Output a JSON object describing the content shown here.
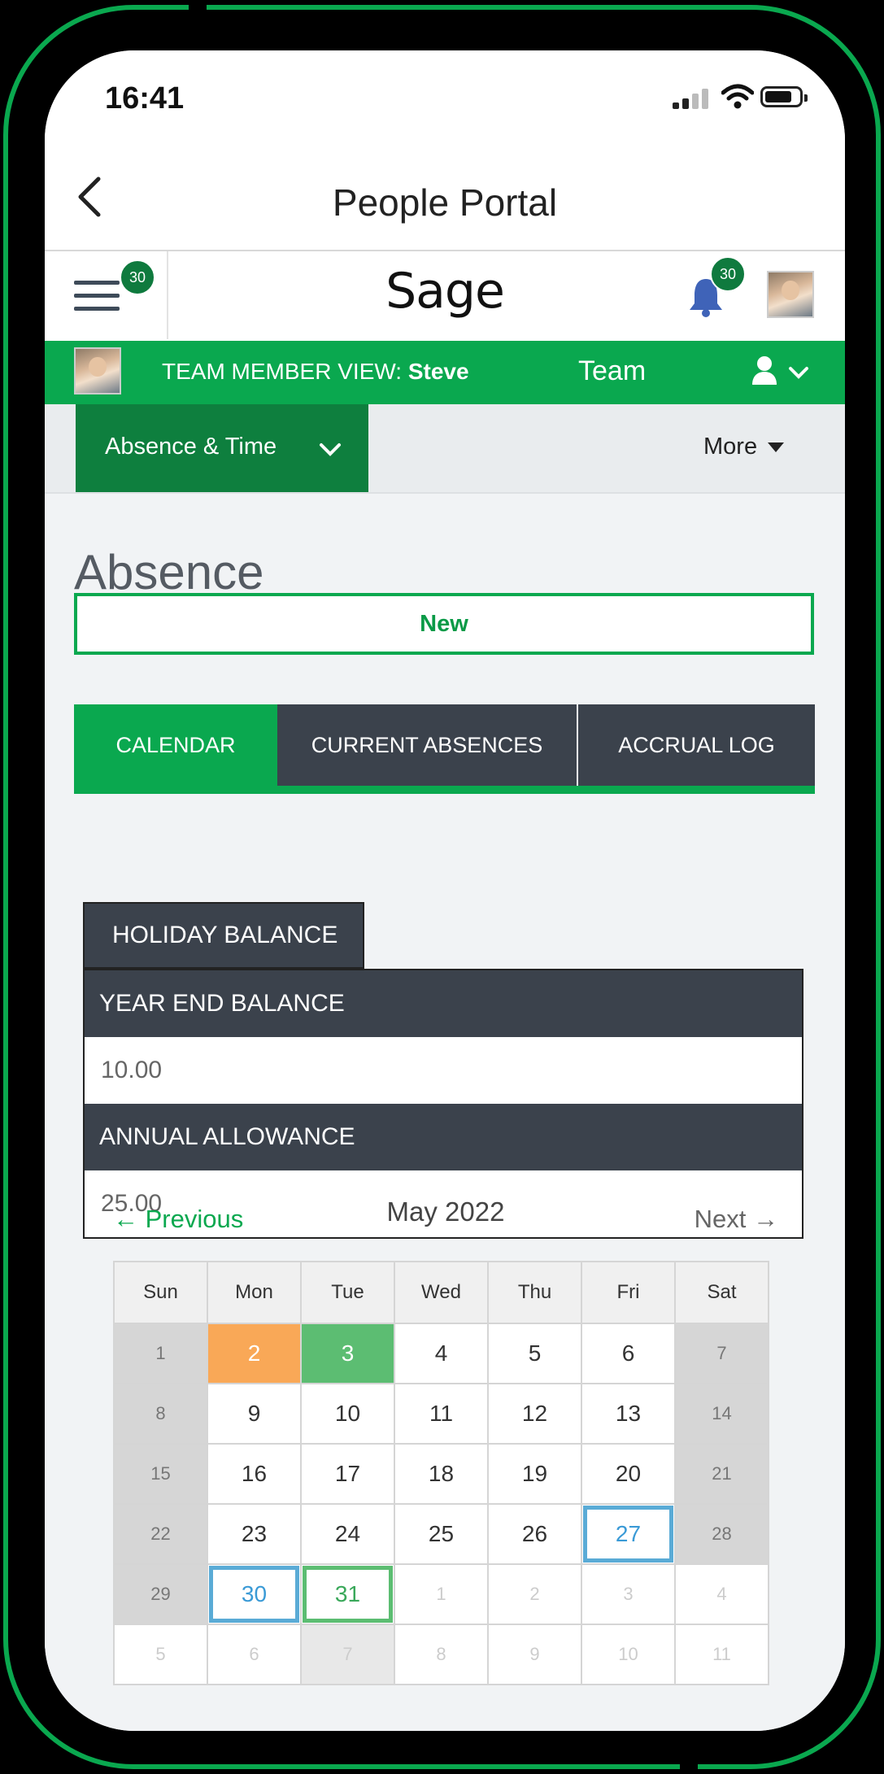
{
  "status_bar": {
    "time": "16:41"
  },
  "nav": {
    "title": "People Portal"
  },
  "sage_bar": {
    "logo": "Sage",
    "menu_badge": "30",
    "notification_badge": "30"
  },
  "team_bar": {
    "view_label": "TEAM MEMBER VIEW:",
    "user_name": "Steve",
    "team_label": "Team"
  },
  "subnav": {
    "section": "Absence & Time",
    "more": "More"
  },
  "page": {
    "heading": "Absence",
    "new_button": "New"
  },
  "tabs": [
    {
      "label": "CALENDAR",
      "active": true
    },
    {
      "label": "CURRENT ABSENCES",
      "active": false
    },
    {
      "label": "ACCRUAL LOG",
      "active": false
    }
  ],
  "balance": {
    "header": "HOLIDAY BALANCE",
    "rows": [
      {
        "label": "YEAR END BALANCE",
        "value": "10.00"
      },
      {
        "label": "ANNUAL ALLOWANCE",
        "value": "25.00"
      }
    ]
  },
  "calendar": {
    "prev": "← Previous",
    "month": "May 2022",
    "next": "Next →",
    "weekdays": [
      "Sun",
      "Mon",
      "Tue",
      "Wed",
      "Thu",
      "Fri",
      "Sat"
    ],
    "weeks": [
      [
        {
          "d": "1",
          "t": "weekend"
        },
        {
          "d": "2",
          "t": "orange"
        },
        {
          "d": "3",
          "t": "green"
        },
        {
          "d": "4"
        },
        {
          "d": "5"
        },
        {
          "d": "6"
        },
        {
          "d": "7",
          "t": "weekend"
        }
      ],
      [
        {
          "d": "8",
          "t": "weekend"
        },
        {
          "d": "9"
        },
        {
          "d": "10"
        },
        {
          "d": "11"
        },
        {
          "d": "12"
        },
        {
          "d": "13"
        },
        {
          "d": "14",
          "t": "weekend"
        }
      ],
      [
        {
          "d": "15",
          "t": "weekend"
        },
        {
          "d": "16"
        },
        {
          "d": "17"
        },
        {
          "d": "18"
        },
        {
          "d": "19"
        },
        {
          "d": "20"
        },
        {
          "d": "21",
          "t": "weekend"
        }
      ],
      [
        {
          "d": "22",
          "t": "weekend"
        },
        {
          "d": "23"
        },
        {
          "d": "24"
        },
        {
          "d": "25"
        },
        {
          "d": "26"
        },
        {
          "d": "27",
          "t": "blue-out"
        },
        {
          "d": "28",
          "t": "weekend"
        }
      ],
      [
        {
          "d": "29",
          "t": "weekend"
        },
        {
          "d": "30",
          "t": "blue-out"
        },
        {
          "d": "31",
          "t": "green-out"
        },
        {
          "d": "1",
          "t": "other"
        },
        {
          "d": "2",
          "t": "other"
        },
        {
          "d": "3",
          "t": "other"
        },
        {
          "d": "4",
          "t": "other"
        }
      ],
      [
        {
          "d": "5",
          "t": "other"
        },
        {
          "d": "6",
          "t": "other"
        },
        {
          "d": "7",
          "t": "other grey"
        },
        {
          "d": "8",
          "t": "other"
        },
        {
          "d": "9",
          "t": "other"
        },
        {
          "d": "10",
          "t": "other"
        },
        {
          "d": "11",
          "t": "other"
        }
      ]
    ]
  },
  "colors": {
    "brand_green": "#0aa84f",
    "dark_green": "#0e7f3e",
    "dark_slate": "#3b424c",
    "absence_orange": "#f9a857",
    "absence_green": "#5cbd72",
    "highlight_blue": "#5aabd6"
  },
  "icons": [
    "back-chevron-icon",
    "menu-icon",
    "bell-icon",
    "person-icon",
    "chevron-down-icon",
    "caret-down-icon",
    "signal-icon",
    "wifi-icon",
    "battery-icon"
  ]
}
